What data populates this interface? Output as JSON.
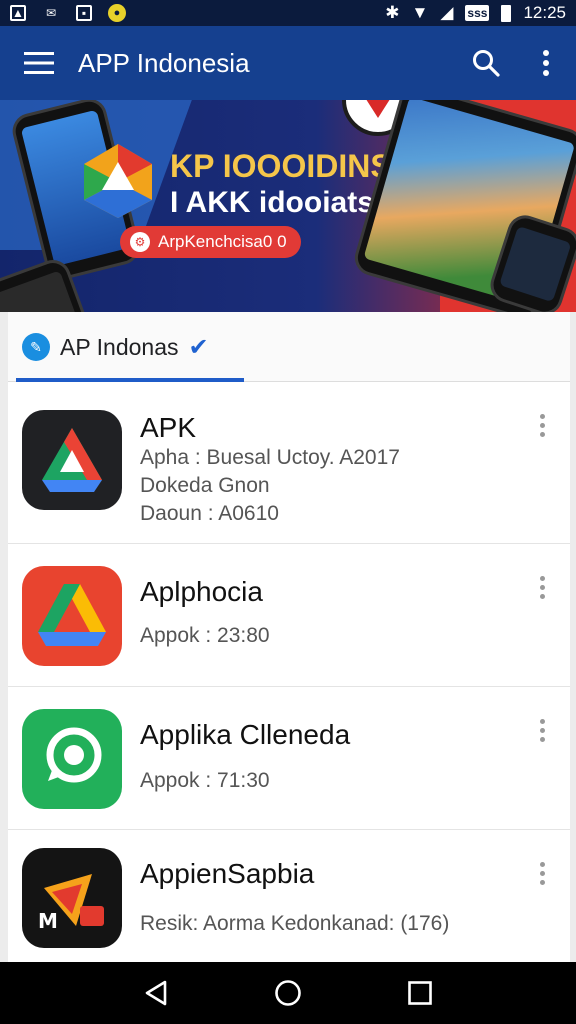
{
  "status_bar": {
    "time": "12:25",
    "carrier_label": "sss"
  },
  "app_bar": {
    "title": "APP Indonesia"
  },
  "banner": {
    "headline_1": "KP IOOOIDINSAI",
    "headline_2": "I AKK idooiatsia",
    "pill_text": "ArpKenchcisa0 0"
  },
  "tab": {
    "label": "AP Indonas"
  },
  "apps": [
    {
      "name": "APK",
      "lines": [
        "Apha : Buesal Uctoy. A2017",
        "Dokeda Gnon",
        "Daoun : A0610"
      ]
    },
    {
      "name": "Aplphocia",
      "lines": [
        "Appok : 23:80"
      ]
    },
    {
      "name": "Applika Clleneda",
      "lines": [
        "Appok : 71:30"
      ]
    },
    {
      "name": "AppienSapbia",
      "lines": [
        "Resik: Aorma Kedonkanad: (176)"
      ]
    }
  ],
  "colors": {
    "app_bar": "#15408f",
    "accent": "#1f5cc8",
    "banner_red": "#d92a28"
  }
}
